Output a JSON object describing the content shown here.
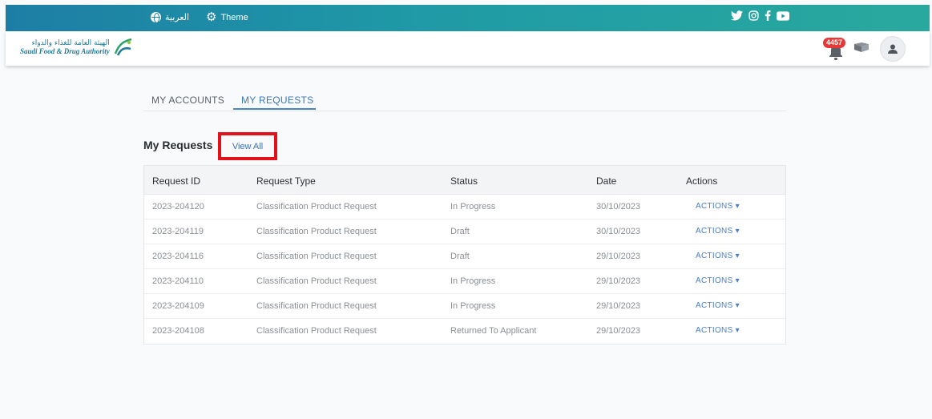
{
  "topbar": {
    "lang_label": "العربية",
    "theme_label": "Theme",
    "socials": [
      "twitter-icon",
      "instagram-icon",
      "facebook-icon",
      "youtube-icon"
    ]
  },
  "header": {
    "logo_ar": "الهيئة العامة للغذاء والدواء",
    "logo_en": "Saudi Food & Drug Authority",
    "notification_count": "4457"
  },
  "tabs": [
    {
      "label": "MY ACCOUNTS",
      "active": false
    },
    {
      "label": "MY REQUESTS",
      "active": true
    }
  ],
  "section": {
    "title": "My Requests",
    "view_all": "View All"
  },
  "table": {
    "columns": [
      "Request ID",
      "Request Type",
      "Status",
      "Date",
      "Actions"
    ],
    "rows": [
      {
        "id": "2023-204120",
        "type": "Classification Product Request",
        "status": "In Progress",
        "date": "30/10/2023",
        "action": "ACTIONS ▾"
      },
      {
        "id": "2023-204119",
        "type": "Classification Product Request",
        "status": "Draft",
        "date": "30/10/2023",
        "action": "ACTIONS ▾"
      },
      {
        "id": "2023-204116",
        "type": "Classification Product Request",
        "status": "Draft",
        "date": "29/10/2023",
        "action": "ACTIONS ▾"
      },
      {
        "id": "2023-204110",
        "type": "Classification Product Request",
        "status": "In Progress",
        "date": "29/10/2023",
        "action": "ACTIONS ▾"
      },
      {
        "id": "2023-204109",
        "type": "Classification Product Request",
        "status": "In Progress",
        "date": "29/10/2023",
        "action": "ACTIONS ▾"
      },
      {
        "id": "2023-204108",
        "type": "Classification Product Request",
        "status": "Returned To Applicant",
        "date": "29/10/2023",
        "action": "ACTIONS ▾"
      }
    ]
  },
  "colors": {
    "topbar_start": "#1d7ea5",
    "topbar_end": "#29a99e",
    "accent": "#3b78b6",
    "highlight_box": "#e1121a",
    "badge": "#e53935"
  }
}
